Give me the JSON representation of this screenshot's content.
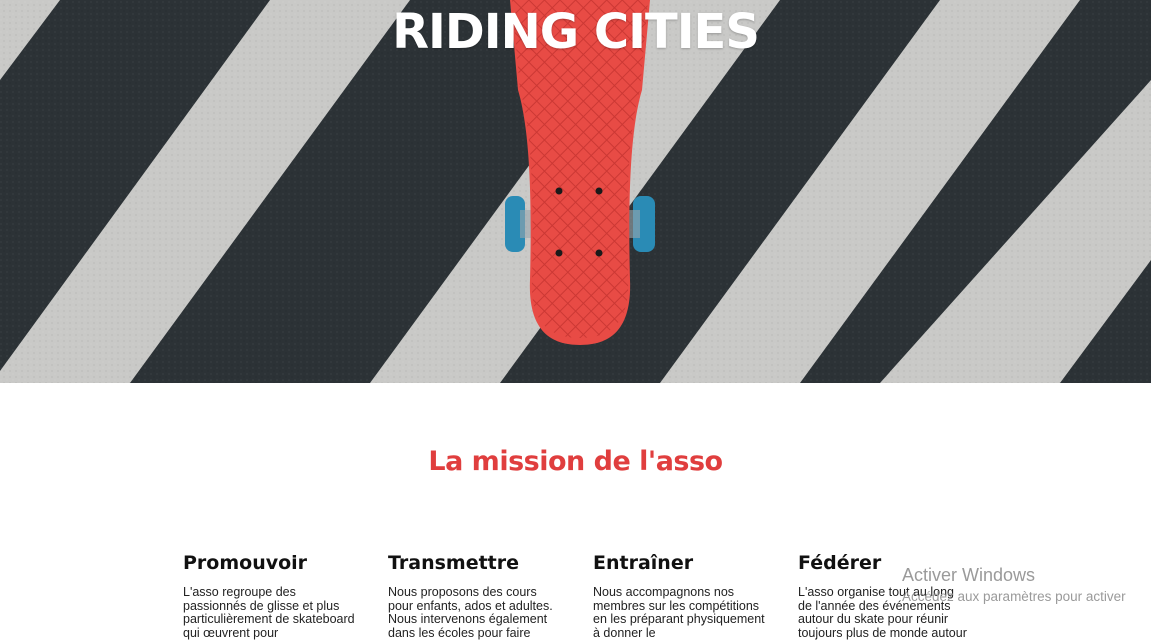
{
  "hero": {
    "title": "RIDING CITIES",
    "image_alt": "red skateboard on crosswalk stripes"
  },
  "mission": {
    "title": "La mission de l'asso",
    "columns": [
      {
        "heading": "Promouvoir",
        "text": "L'asso regroupe des passionnés de glisse et plus particulièrement de skateboard qui œuvrent pour"
      },
      {
        "heading": "Transmettre",
        "text": "Nous proposons des cours pour enfants, ados et adultes. Nous intervenons également dans les écoles pour faire"
      },
      {
        "heading": "Entraîner",
        "text": "Nous accompagnons nos membres sur les compétitions en les préparant physiquement à donner le"
      },
      {
        "heading": "Fédérer",
        "text": "L'asso organise tout au long de l'année des événements autour du skate pour réunir toujours plus de monde autour"
      }
    ]
  },
  "watermark": {
    "line1": "Activer Windows",
    "line2": "Accédez aux paramètres pour activer"
  },
  "colors": {
    "accent": "#e03e3e",
    "asphalt": "#2c3236",
    "stripe": "#c9c9c7",
    "board": "#e84b45",
    "wheel": "#2a8bb5"
  }
}
